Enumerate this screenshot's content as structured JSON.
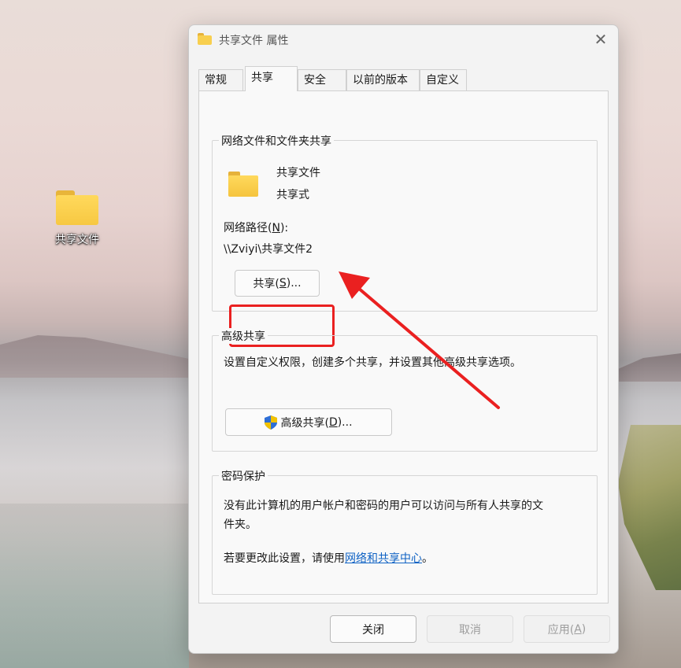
{
  "desktop": {
    "folder_label": "共享文件"
  },
  "dialog": {
    "title": "共享文件 属性",
    "close_symbol": "✕",
    "tabs": [
      {
        "label": "常规"
      },
      {
        "label": "共享"
      },
      {
        "label": "安全"
      },
      {
        "label": "以前的版本"
      },
      {
        "label": "自定义"
      }
    ],
    "active_tab": "共享",
    "network_sharing": {
      "legend": "网络文件和文件夹共享",
      "folder_name": "共享文件",
      "share_status": "共享式",
      "network_path_label_prefix": "网络路径(",
      "network_path_label_key": "N",
      "network_path_label_suffix": "):",
      "network_path_value": "\\\\Zviyi\\共享文件2",
      "share_button_prefix": "共享(",
      "share_button_key": "S",
      "share_button_suffix": ")..."
    },
    "advanced_sharing": {
      "legend": "高级共享",
      "description": "设置自定义权限，创建多个共享，并设置其他高级共享选项。",
      "button_prefix": "高级共享(",
      "button_key": "D",
      "button_suffix": ")..."
    },
    "password_protection": {
      "legend": "密码保护",
      "line1": "没有此计算机的用户帐户和密码的用户可以访问与所有人共享的文",
      "line2": "件夹。",
      "change_prefix": "若要更改此设置，请使用",
      "change_link": "网络和共享中心",
      "change_suffix": "。"
    },
    "footer": {
      "close_label": "关闭",
      "cancel_label": "取消",
      "apply_prefix": "应用(",
      "apply_key": "A",
      "apply_suffix": ")"
    }
  },
  "annotation": {
    "highlight_color": "#ea2020",
    "arrow_color": "#ea2020"
  }
}
